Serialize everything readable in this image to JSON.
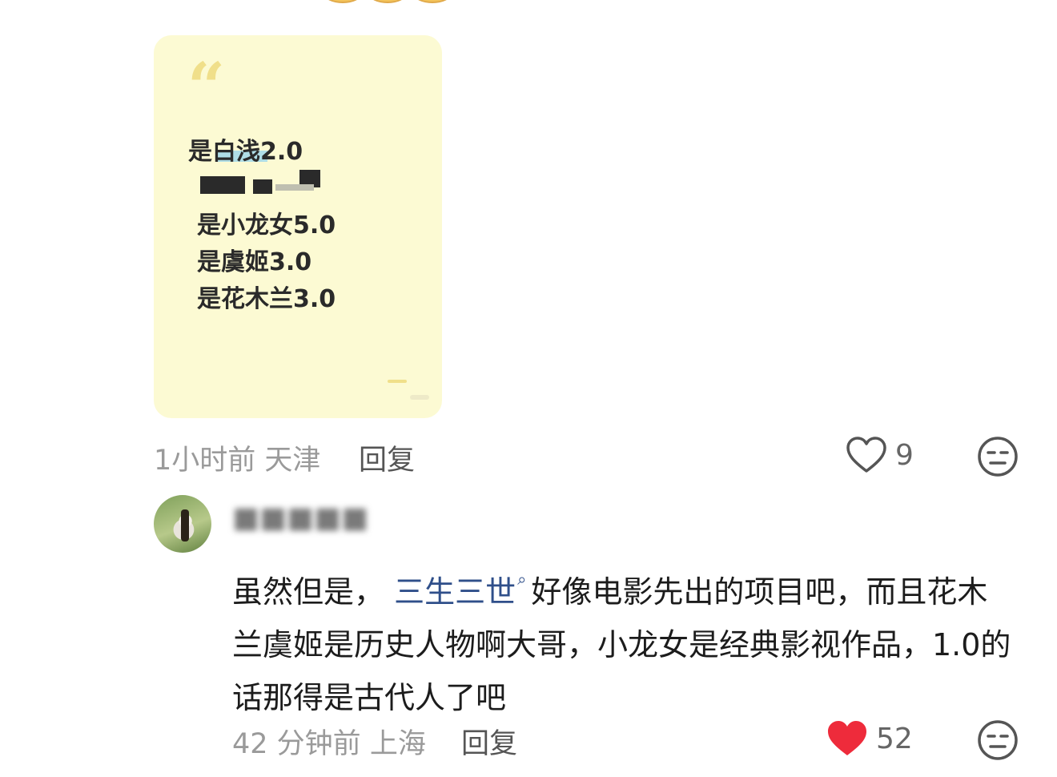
{
  "card": {
    "lines": [
      "是白浅2.0",
      "是小龙女5.0",
      "是虞姬3.0",
      "是花木兰3.0"
    ],
    "quote_icon": "left-double-quote-icon"
  },
  "comment1": {
    "time": "1小时前",
    "location": "天津",
    "reply_label": "回复",
    "likes": "9",
    "liked": false,
    "like_icon": "heart-outline-icon",
    "dislike_icon": "meh-face-icon"
  },
  "comment2": {
    "text_before": "虽然但是，",
    "link_text": "三生三世",
    "search_icon": "search-icon",
    "text_after": "好像电影先出的项目吧，而且花木兰虞姬是历史人物啊大哥，小龙女是经典影视作品，1.0的话那得是古代人了吧",
    "time": "42 分钟前",
    "location": "上海",
    "reply_label": "回复",
    "likes": "52",
    "liked": true,
    "like_color": "#ee2b3b",
    "like_icon": "heart-filled-icon",
    "dislike_icon": "meh-face-icon"
  }
}
